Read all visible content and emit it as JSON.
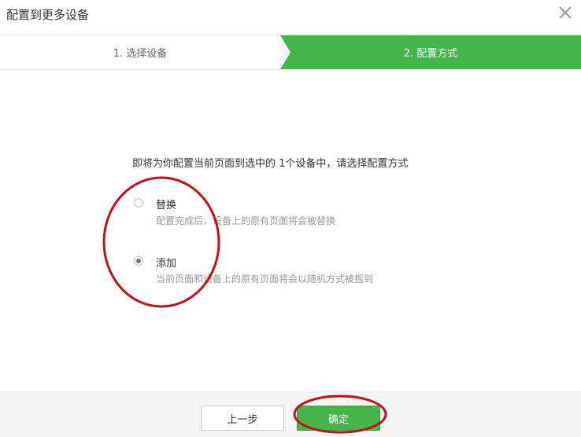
{
  "dialog": {
    "title": "配置到更多设备",
    "close_icon": "close-icon"
  },
  "steps": [
    {
      "label": "1. 选择设备",
      "active": false
    },
    {
      "label": "2. 配置方式",
      "active": true
    }
  ],
  "prompt": "即将为你配置当前页面到选中的 1个设备中，请选择配置方式",
  "options": [
    {
      "label": "替换",
      "description": "配置完成后，设备上的原有页面将会被替换",
      "selected": false
    },
    {
      "label": "添加",
      "description": "当前页面和设备上的原有页面将会以随机方式被摇到",
      "selected": true
    }
  ],
  "buttons": {
    "prev": "上一步",
    "confirm": "确定"
  },
  "colors": {
    "accent": "#44b549",
    "annotation": "#c4101a"
  }
}
